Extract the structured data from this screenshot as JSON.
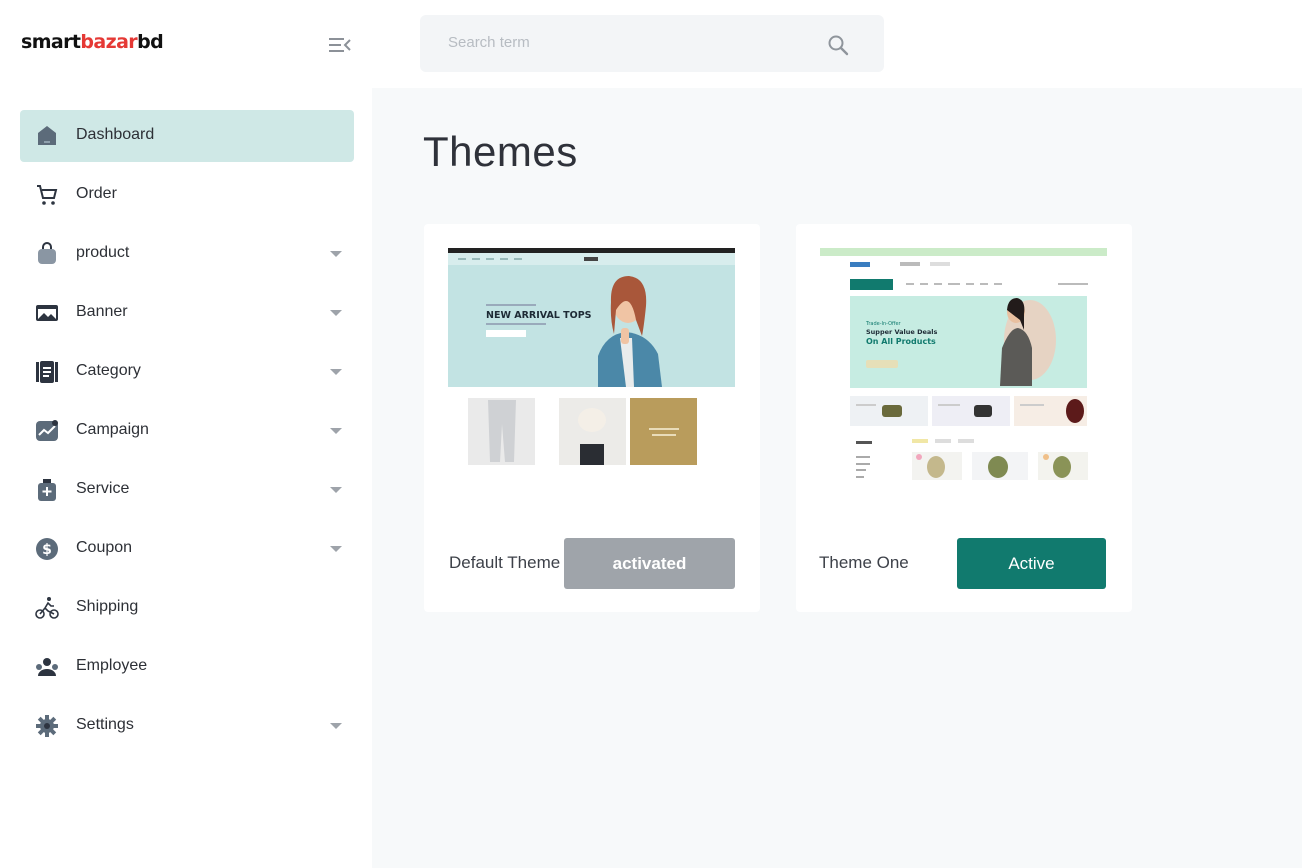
{
  "brand": {
    "logo_part1": "smart",
    "logo_part2": "bazar",
    "logo_part3": "bd",
    "accent_color": "#e53935"
  },
  "sidebar": {
    "items": [
      {
        "label": "Dashboard",
        "icon": "home-icon",
        "active": true,
        "has_submenu": false
      },
      {
        "label": "Order",
        "icon": "cart-icon",
        "active": false,
        "has_submenu": false
      },
      {
        "label": "product",
        "icon": "bag-icon",
        "active": false,
        "has_submenu": true
      },
      {
        "label": "Banner",
        "icon": "image-icon",
        "active": false,
        "has_submenu": true
      },
      {
        "label": "Category",
        "icon": "document-icon",
        "active": false,
        "has_submenu": true
      },
      {
        "label": "Campaign",
        "icon": "chart-icon",
        "active": false,
        "has_submenu": true
      },
      {
        "label": "Service",
        "icon": "medkit-icon",
        "active": false,
        "has_submenu": true
      },
      {
        "label": "Coupon",
        "icon": "dollar-icon",
        "active": false,
        "has_submenu": true
      },
      {
        "label": "Shipping",
        "icon": "bike-icon",
        "active": false,
        "has_submenu": false
      },
      {
        "label": "Employee",
        "icon": "people-icon",
        "active": false,
        "has_submenu": false
      },
      {
        "label": "Settings",
        "icon": "gear-icon",
        "active": false,
        "has_submenu": true
      }
    ],
    "active_bg": "#cfe8e6"
  },
  "search": {
    "placeholder": "Search term",
    "value": ""
  },
  "main": {
    "title": "Themes",
    "themes": [
      {
        "name": "Default Theme",
        "button_label": "activated",
        "button_state": "activated",
        "preview": {
          "hero_text": "NEW ARRIVAL TOPS"
        }
      },
      {
        "name": "Theme One",
        "button_label": "Active",
        "button_state": "active",
        "preview": {
          "hero_line1": "Trade-In-Offer",
          "hero_line2": "Supper Value Deals",
          "hero_line3": "On All Products"
        }
      }
    ]
  },
  "colors": {
    "primary": "#117a6e",
    "disabled": "#9fa4aa"
  }
}
